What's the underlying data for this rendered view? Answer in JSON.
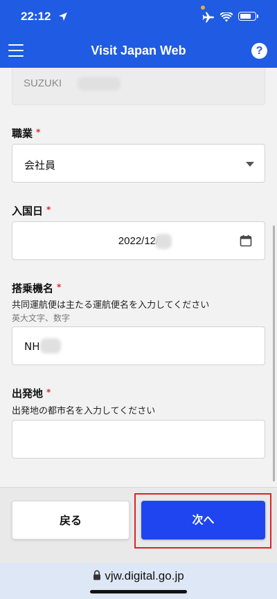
{
  "status_bar": {
    "time": "22:12",
    "location_icon": "location-arrow-icon",
    "airplane_icon": "airplane-icon",
    "wifi_icon": "wifi-icon",
    "battery_icon": "battery-icon"
  },
  "header": {
    "title": "Visit Japan Web",
    "menu_icon": "hamburger-menu-icon",
    "help_label": "?"
  },
  "form": {
    "name_value": "SUZUKI",
    "occupation": {
      "label": "職業",
      "required_mark": "*",
      "value": "会社員",
      "dropdown_icon": "chevron-down-icon"
    },
    "entry_date": {
      "label": "入国日",
      "required_mark": "*",
      "value": "2022/12/",
      "calendar_icon": "calendar-icon"
    },
    "flight": {
      "label": "搭乗機名",
      "required_mark": "*",
      "hint": "共同運航便は主たる運航便名を入力してください",
      "subhint": "英大文字、数字",
      "value": "NH"
    },
    "departure": {
      "label": "出発地",
      "required_mark": "*",
      "hint": "出発地の都市名を入力してください",
      "value": ""
    }
  },
  "footer": {
    "back_label": "戻る",
    "next_label": "次へ",
    "highlight_color": "#e0202a"
  },
  "browser": {
    "url": "vjw.digital.go.jp",
    "lock_icon": "lock-icon"
  },
  "colors": {
    "brand_blue": "#1f5be3",
    "primary_button": "#1f45f0",
    "required": "#e0242c"
  }
}
